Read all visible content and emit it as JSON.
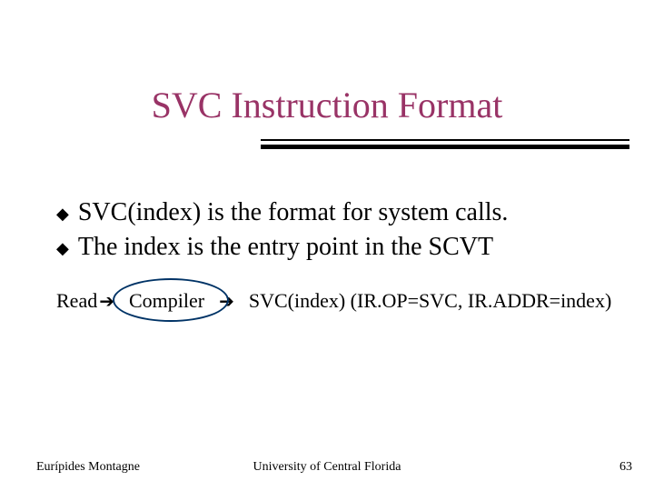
{
  "title": "SVC Instruction Format",
  "bullets": [
    "SVC(index) is the format for system calls.",
    "The index is the entry point in the SCVT"
  ],
  "flow": {
    "input": "Read",
    "compiler": "Compiler",
    "output": "SVC(index) (IR.OP=SVC, IR.ADDR=index)"
  },
  "footer": {
    "author": "Eurípides Montagne",
    "org": "University of Central Florida",
    "page": "63"
  },
  "glyphs": {
    "diamond": "◆",
    "arrow": "➔"
  }
}
